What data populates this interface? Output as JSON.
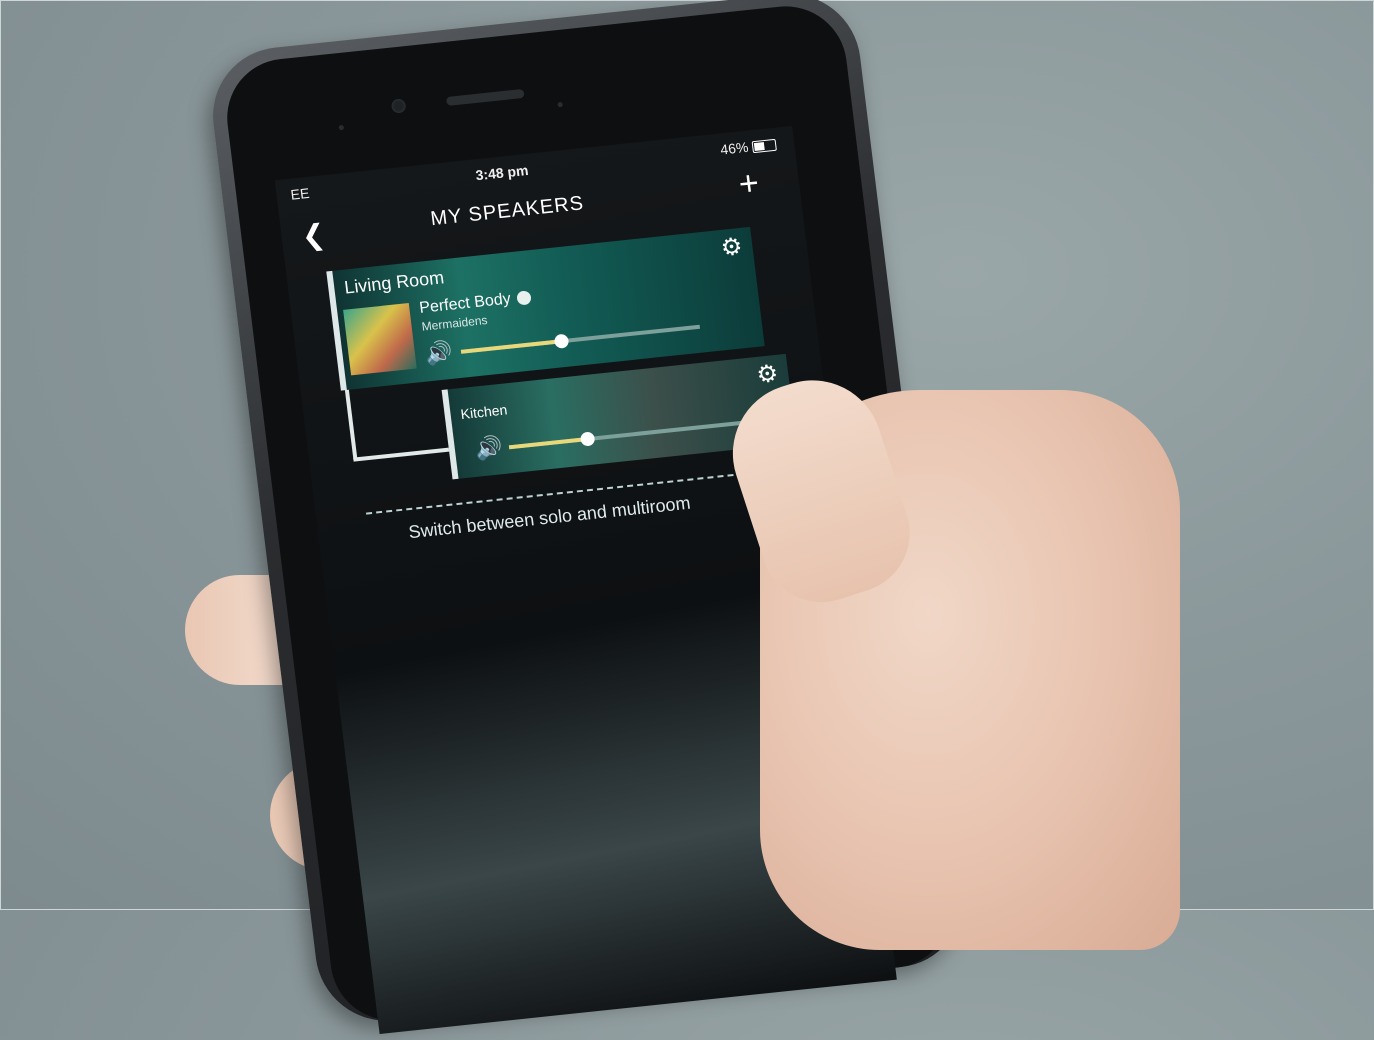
{
  "status_bar": {
    "carrier": "EE",
    "time": "3:48 pm",
    "battery": "46%"
  },
  "header": {
    "title": "MY SPEAKERS",
    "back_icon": "chevron-left-icon",
    "add_icon": "plus-icon"
  },
  "speakers": [
    {
      "room": "Living Room",
      "track": "Perfect Body",
      "artist": "Mermaidens",
      "volume_fraction": 0.42,
      "settings_icon": "gear-icon"
    },
    {
      "room": "Kitchen",
      "volume_fraction": 0.33,
      "settings_icon": "gear-icon"
    }
  ],
  "footer": {
    "switch_label": "Switch between solo and multiroom"
  },
  "colors": {
    "card_teal": "#1d7164",
    "slider_fill": "#e8d87a"
  }
}
